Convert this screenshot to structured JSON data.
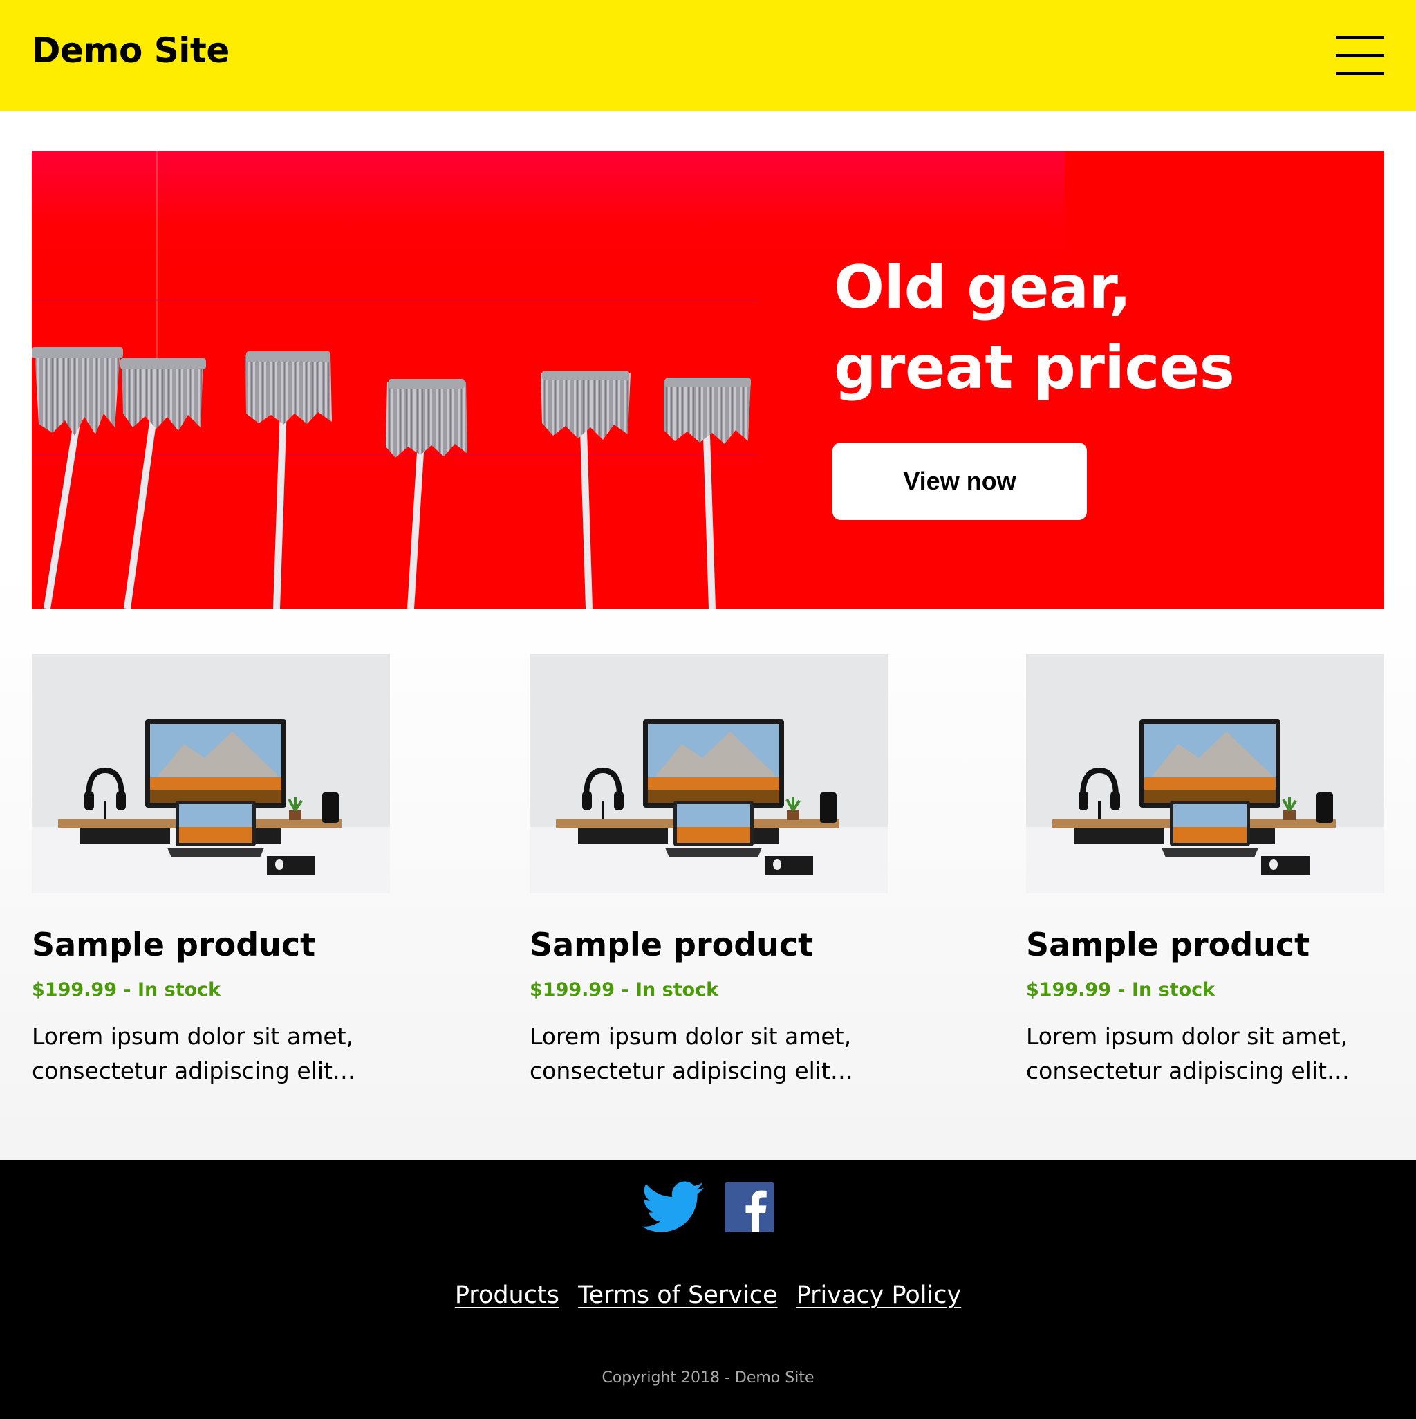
{
  "header": {
    "site_title": "Demo Site",
    "menu_icon": "hamburger-menu-icon"
  },
  "hero": {
    "heading_line1": "Old gear,",
    "heading_line2": "great prices",
    "button_label": "View now",
    "background_color": "#ff0000"
  },
  "products": [
    {
      "name": "Sample product",
      "price_status": "$199.99 - In stock",
      "description_line1": "Lorem ipsum dolor sit amet,",
      "description_line2": "consectetur adipiscing elit…"
    },
    {
      "name": "Sample product",
      "price_status": "$199.99 - In stock",
      "description_line1": "Lorem ipsum dolor sit amet,",
      "description_line2": "consectetur adipiscing elit…"
    },
    {
      "name": "Sample product",
      "price_status": "$199.99 - In stock",
      "description_line1": "Lorem ipsum dolor sit amet,",
      "description_line2": "consectetur adipiscing elit…"
    }
  ],
  "footer": {
    "social_icons": [
      "twitter-icon",
      "facebook-icon"
    ],
    "links": [
      "Products",
      "Terms of Service",
      "Privacy Policy"
    ],
    "copyright": "Copyright 2018 - Demo Site"
  },
  "colors": {
    "header_bg": "#ffed00",
    "price_green": "#4b9a08",
    "footer_bg": "#000000",
    "twitter_blue": "#1da1f2",
    "facebook_blue": "#3b5998"
  }
}
